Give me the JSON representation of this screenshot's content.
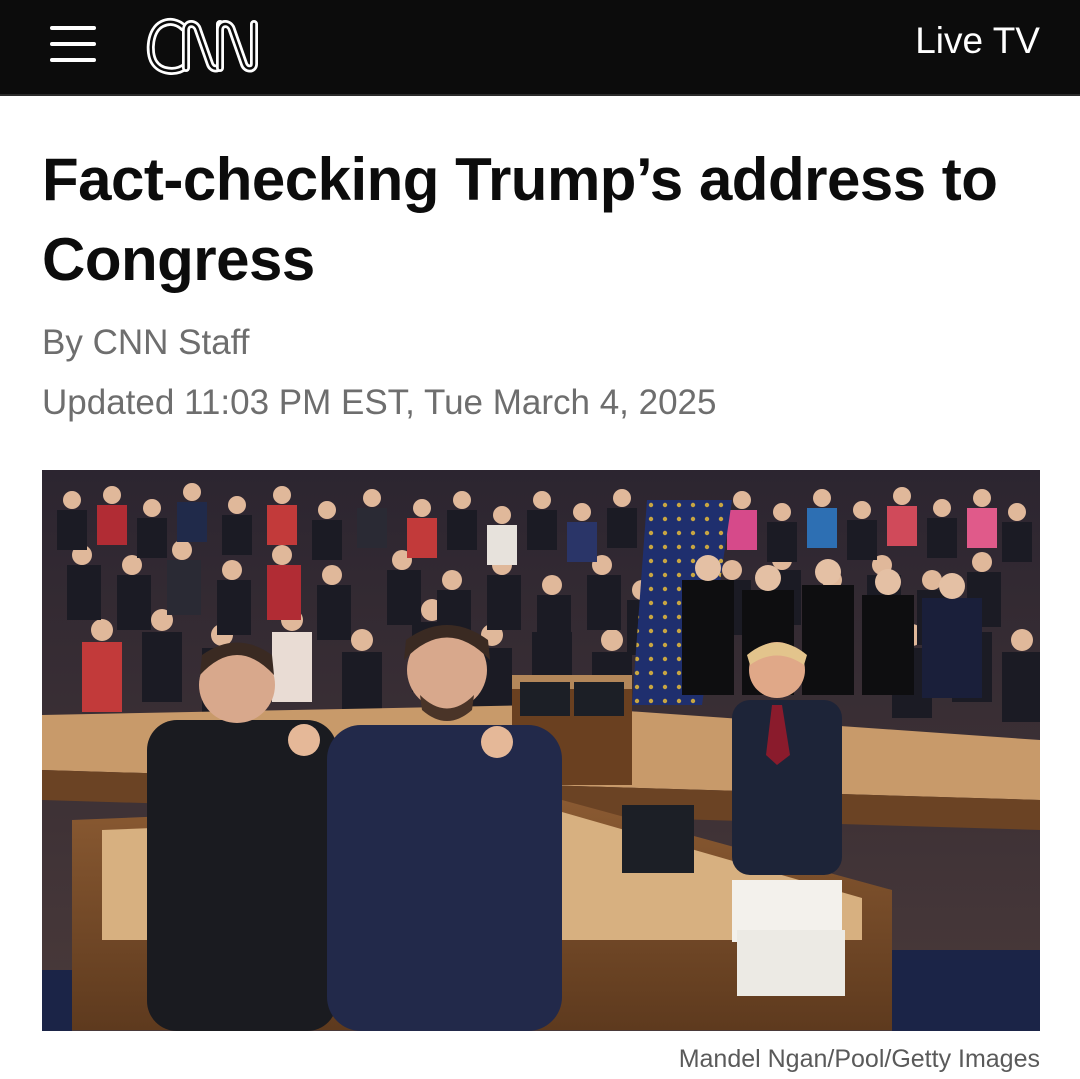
{
  "header": {
    "logo_text": "CNN",
    "live_tv_label": "Live TV",
    "background_color": "#0c0c0c",
    "menu_icon": "hamburger-menu-icon"
  },
  "article": {
    "headline": "Fact-checking Trump’s address to Congress",
    "byline": "By CNN Staff",
    "timestamp": "Updated 11:03 PM EST, Tue March 4, 2025",
    "photo_credit": "Mandel Ngan/Pool/Getty Images"
  },
  "colors": {
    "headline": "#0c0c0c",
    "meta_text": "#6e6e6e",
    "credit_text": "#5a5a5a"
  }
}
